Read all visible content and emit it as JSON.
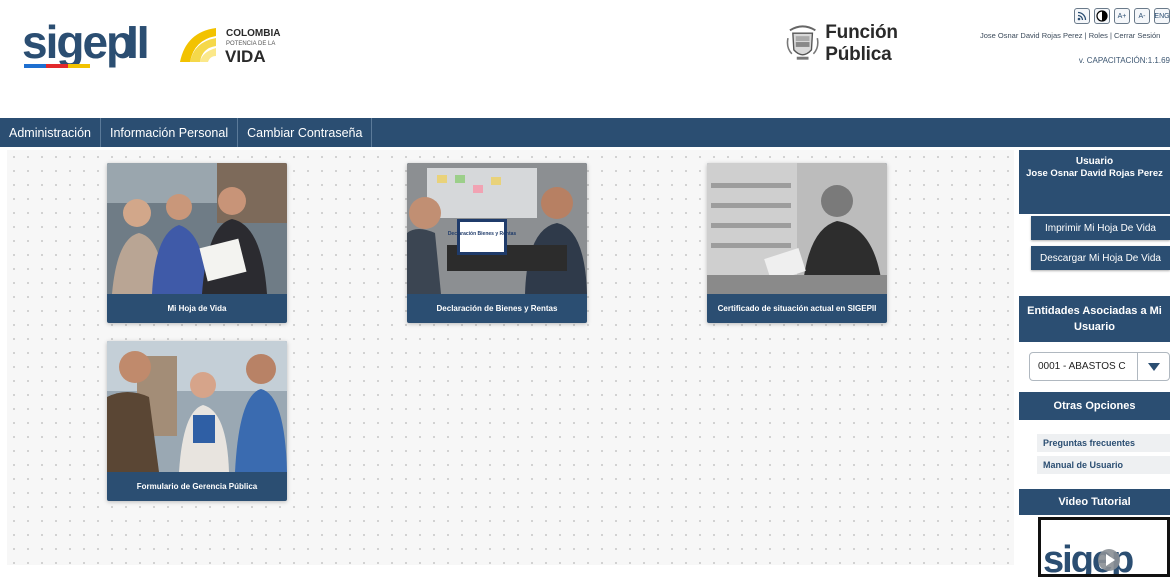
{
  "header": {
    "brand_name": "sigep",
    "brand_suffix": "II",
    "colombia_line1": "COLOMBIA",
    "colombia_line2": "POTENCIA DE LA",
    "colombia_line3": "VIDA",
    "funcion_publica": "Función Pública",
    "accessibility": {
      "rss": "RSS",
      "font_up": "A+",
      "font_down": "A-",
      "language": "ENG"
    },
    "user_name": "Jose Osnar David Rojas Perez",
    "separator": "|",
    "roles_link": "Roles",
    "logout_link": "Cerrar Sesión",
    "version": "v. CAPACITACIÓN:1.1.69"
  },
  "nav": {
    "items": [
      {
        "label": "Administración"
      },
      {
        "label": "Información Personal"
      },
      {
        "label": "Cambiar Contraseña"
      }
    ]
  },
  "cards": [
    {
      "caption": "Mi Hoja de Vida"
    },
    {
      "caption": "Declaración de Bienes y Rentas",
      "sign_text": "Declaración Bienes y Rentas"
    },
    {
      "caption": "Certificado de situación actual en SIGEPII"
    },
    {
      "caption": "Formulario de Gerencia Pública"
    }
  ],
  "sidebar": {
    "user_heading": "Usuario",
    "user_name": "Jose Osnar David Rojas Perez",
    "print_cv": "Imprimir Mi Hoja De Vida",
    "download_cv": "Descargar Mi Hoja De Vida",
    "entities_heading": "Entidades Asociadas a Mi Usuario",
    "entity_selected": "0001 - ABASTOS C",
    "other_options_heading": "Otras Opciones",
    "links": [
      {
        "label": "Preguntas frecuentes"
      },
      {
        "label": "Manual de Usuario"
      }
    ],
    "video_heading": "Video Tutorial"
  }
}
